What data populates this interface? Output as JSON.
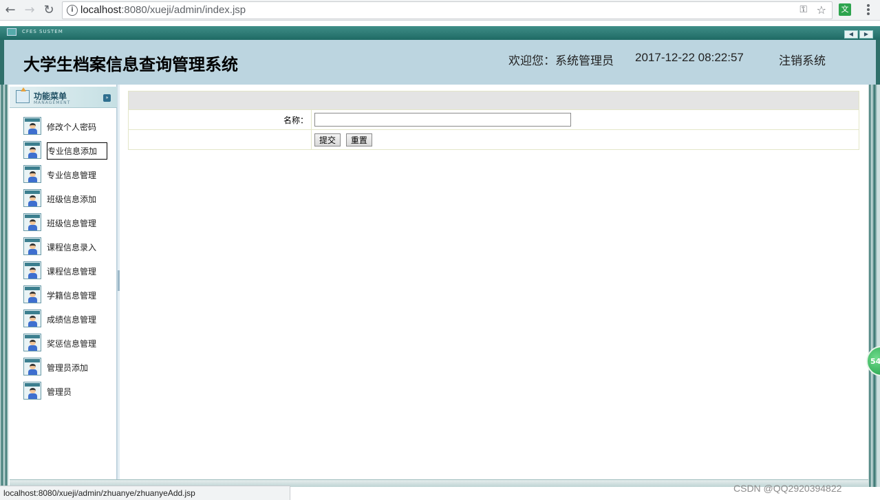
{
  "browser": {
    "url_host": "localhost",
    "url_rest": ":8080/xueji/admin/index.jsp",
    "translate_label": "文",
    "status_url": "localhost:8080/xueji/admin/zhuanye/zhuanyeAdd.jsp"
  },
  "app": {
    "topbar_text": "CFES SUSTEM",
    "title": "大学生档案信息查询管理系统",
    "welcome": "欢迎您：系统管理员",
    "datetime": "2017-12-22 08:22:57",
    "logout": "注销系统"
  },
  "sidebar": {
    "title": "功能菜单",
    "subtitle": "MANAGEMENT",
    "items": [
      {
        "label": "修改个人密码"
      },
      {
        "label": "专业信息添加"
      },
      {
        "label": "专业信息管理"
      },
      {
        "label": "班级信息添加"
      },
      {
        "label": "班级信息管理"
      },
      {
        "label": "课程信息录入"
      },
      {
        "label": "课程信息管理"
      },
      {
        "label": "学籍信息管理"
      },
      {
        "label": "成绩信息管理"
      },
      {
        "label": "奖惩信息管理"
      },
      {
        "label": "管理员添加"
      },
      {
        "label": "管理员"
      }
    ],
    "active_index": 1
  },
  "form": {
    "name_label": "名称：",
    "name_value": "",
    "submit_label": "提交",
    "reset_label": "重置"
  },
  "badge": {
    "text": "54"
  },
  "watermark": "CSDN @QQ2920394822",
  "colors": {
    "frame": "#2f6f6a",
    "header_bg": "#bcd5e0",
    "form_head_bg": "#e4e4e4"
  }
}
